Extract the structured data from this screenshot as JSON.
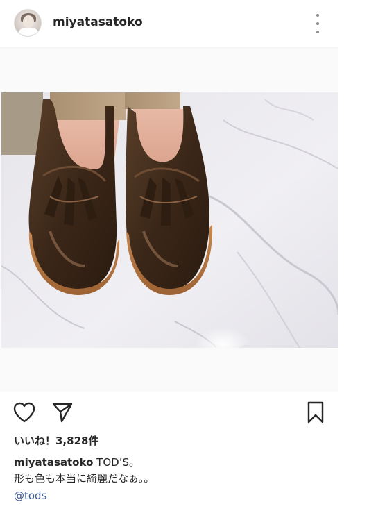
{
  "post": {
    "username": "miyatasatoko",
    "likes_text": "いいね！3,828件",
    "caption_user": "miyatasatoko",
    "caption_line1": "TOD’S。",
    "caption_line2": "形も色も本当に綺麗だなぁ。。",
    "mention": "@tods"
  },
  "icons": {
    "more": "more-options-icon",
    "like": "heart-icon",
    "share": "paper-plane-icon",
    "save": "bookmark-icon"
  },
  "colors": {
    "text": "#262626",
    "link": "#3d5a91",
    "icon": "#262626"
  }
}
